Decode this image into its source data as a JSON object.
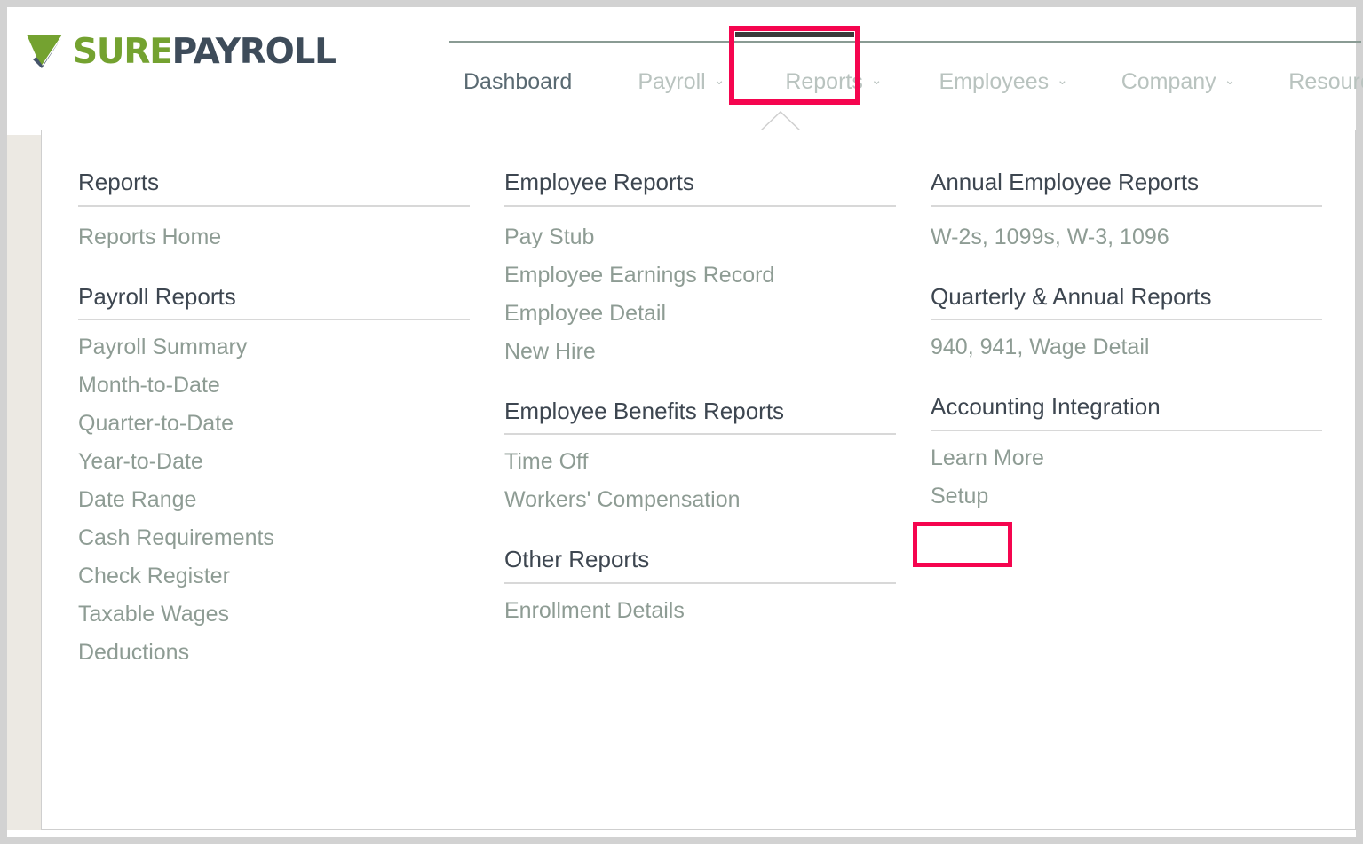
{
  "brand": {
    "logo_icon": "checkmark-logo-icon",
    "name_part1": "SURE",
    "name_part2": "PAYROLL",
    "color_green": "#74a230",
    "color_dark": "#3e4c5a"
  },
  "nav": {
    "items": [
      {
        "label": "Dashboard",
        "has_caret": false,
        "active": true
      },
      {
        "label": "Payroll",
        "has_caret": true,
        "active": false
      },
      {
        "label": "Reports",
        "has_caret": true,
        "active": false,
        "highlighted": true,
        "open": true
      },
      {
        "label": "Employees",
        "has_caret": true,
        "active": false
      },
      {
        "label": "Company",
        "has_caret": true,
        "active": false
      },
      {
        "label": "Resources",
        "has_caret": true,
        "active": false
      }
    ],
    "caret_glyph": "⌄"
  },
  "dropdown": {
    "open_for": "Reports",
    "columns": [
      {
        "id": "column-1",
        "groups": [
          {
            "heading": "Reports",
            "links": [
              "Reports Home"
            ]
          },
          {
            "heading": "Payroll Reports",
            "links": [
              "Payroll Summary",
              "Month-to-Date",
              "Quarter-to-Date",
              "Year-to-Date",
              "Date Range",
              "Cash Requirements",
              "Check Register",
              "Taxable Wages",
              "Deductions"
            ]
          }
        ]
      },
      {
        "id": "column-2",
        "groups": [
          {
            "heading": "Employee Reports",
            "links": [
              "Pay Stub",
              "Employee Earnings Record",
              "Employee Detail",
              "New Hire"
            ]
          },
          {
            "heading": "Employee Benefits Reports",
            "links": [
              "Time Off",
              "Workers' Compensation"
            ]
          },
          {
            "heading": "Other Reports",
            "links": [
              "Enrollment Details"
            ]
          }
        ]
      },
      {
        "id": "column-3",
        "groups": [
          {
            "heading": "Annual Employee Reports",
            "links": [
              "W-2s, 1099s, W-3, 1096"
            ]
          },
          {
            "heading": "Quarterly & Annual Reports",
            "links": [
              "940, 941, Wage Detail"
            ]
          },
          {
            "heading": "Accounting Integration",
            "links": [
              "Learn More",
              "Setup"
            ]
          }
        ]
      }
    ]
  },
  "annotations": {
    "color": "#f5054f",
    "highlighted_elements": [
      "Reports",
      "Setup"
    ]
  }
}
